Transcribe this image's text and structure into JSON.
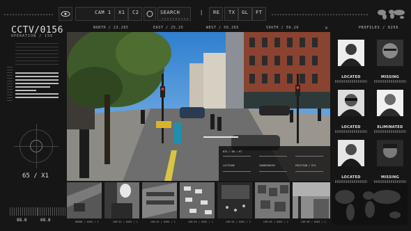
{
  "toolbar": {
    "camera": "CAM 1",
    "x1": "X1",
    "c2": "C2",
    "search": "SEARCH",
    "pipe": "|",
    "re": "RE",
    "tx": "TX",
    "gl": "GL",
    "ft": "FT"
  },
  "left": {
    "title": "CCTV/0156",
    "subtitle": "OPERATION / 156",
    "zoom": "65 / X1",
    "val_left": "88.8",
    "val_right": "68.8"
  },
  "coords": {
    "north": "NORTH / 23.265",
    "east": "EAST / 25.25",
    "west": "WEST / 56.265",
    "south": "SOUTH / 56.26",
    "close": "×"
  },
  "overlay": {
    "c1": "874 / 66 / 67",
    "c2": "LATITUDE",
    "c3": "COORDINATES",
    "c4": "POSITION / 874"
  },
  "thumbs": [
    {
      "label": "DRONE / 0265 / 1"
    },
    {
      "label": "CAM 01 / 0265 / 1"
    },
    {
      "label": "CAM 02 / 0265 / 1"
    },
    {
      "label": "CAM 03 / 0265 / 1"
    },
    {
      "label": "CAM 04 / 0265 / 1"
    },
    {
      "label": "CAM 05 / 0265 / 1"
    },
    {
      "label": "CAM 06 / 0265 / 1"
    }
  ],
  "profiles": {
    "heading": "PROFILES / 0256",
    "cards": [
      {
        "status": "LOCATED"
      },
      {
        "status": "MISSING"
      },
      {
        "status": "LOCATED"
      },
      {
        "status": "ELIMINATED"
      },
      {
        "status": "LOCATED"
      },
      {
        "status": "MISSING"
      }
    ]
  },
  "colors": {
    "background": "#161616",
    "panel": "#1d1d1d",
    "text": "#d9d9d9"
  }
}
